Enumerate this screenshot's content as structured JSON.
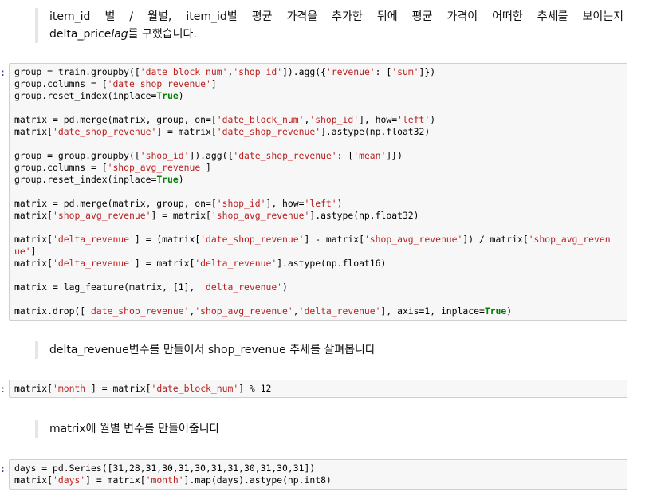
{
  "markdown": {
    "m1_line1": "item_id 별 / 월별, item_id별 평균 가격을 추가한 뒤에 평균 가격이 어떠한 추세를 보이는지",
    "m1_line2_pre": "delta_price",
    "m1_line2_em": "lag",
    "m1_line2_post": "를 구했습니다.",
    "m2": "delta_revenue변수를 만들어서 shop_revenue 추세를 살펴봅니다",
    "m3": "matrix에 월별 변수를 만들어줍니다"
  },
  "prompt_glyph": ":",
  "cells": [
    {
      "lines": [
        [
          [
            "group = train.groupby(["
          ],
          [
            "'date_block_num'",
            "s"
          ],
          [
            ","
          ],
          [
            "'shop_id'",
            "s"
          ],
          [
            "]).agg({"
          ],
          [
            "'revenue'",
            "s"
          ],
          [
            ": ["
          ],
          [
            "'sum'",
            "s"
          ],
          [
            "]})"
          ]
        ],
        [
          [
            "group.columns = ["
          ],
          [
            "'date_shop_revenue'",
            "s"
          ],
          [
            "]"
          ]
        ],
        [
          [
            "group.reset_index(inplace="
          ],
          [
            "True",
            "k"
          ],
          [
            ")"
          ]
        ],
        [
          [
            ""
          ]
        ],
        [
          [
            "matrix = pd.merge(matrix, group, on=["
          ],
          [
            "'date_block_num'",
            "s"
          ],
          [
            ","
          ],
          [
            "'shop_id'",
            "s"
          ],
          [
            "], how="
          ],
          [
            "'left'",
            "s"
          ],
          [
            ")"
          ]
        ],
        [
          [
            "matrix["
          ],
          [
            "'date_shop_revenue'",
            "s"
          ],
          [
            "] = matrix["
          ],
          [
            "'date_shop_revenue'",
            "s"
          ],
          [
            "].astype(np.float32)"
          ]
        ],
        [
          [
            ""
          ]
        ],
        [
          [
            "group = group.groupby(["
          ],
          [
            "'shop_id'",
            "s"
          ],
          [
            "]).agg({"
          ],
          [
            "'date_shop_revenue'",
            "s"
          ],
          [
            ": ["
          ],
          [
            "'mean'",
            "s"
          ],
          [
            "]})"
          ]
        ],
        [
          [
            "group.columns = ["
          ],
          [
            "'shop_avg_revenue'",
            "s"
          ],
          [
            "]"
          ]
        ],
        [
          [
            "group.reset_index(inplace="
          ],
          [
            "True",
            "k"
          ],
          [
            ")"
          ]
        ],
        [
          [
            ""
          ]
        ],
        [
          [
            "matrix = pd.merge(matrix, group, on=["
          ],
          [
            "'shop_id'",
            "s"
          ],
          [
            "], how="
          ],
          [
            "'left'",
            "s"
          ],
          [
            ")"
          ]
        ],
        [
          [
            "matrix["
          ],
          [
            "'shop_avg_revenue'",
            "s"
          ],
          [
            "] = matrix["
          ],
          [
            "'shop_avg_revenue'",
            "s"
          ],
          [
            "].astype(np.float32)"
          ]
        ],
        [
          [
            ""
          ]
        ],
        [
          [
            "matrix["
          ],
          [
            "'delta_revenue'",
            "s"
          ],
          [
            "] = (matrix["
          ],
          [
            "'date_shop_revenue'",
            "s"
          ],
          [
            "] - matrix["
          ],
          [
            "'shop_avg_revenue'",
            "s"
          ],
          [
            "]) / matrix["
          ],
          [
            "'shop_avg_reven",
            "s"
          ]
        ],
        [
          [
            "ue'",
            "s"
          ],
          [
            "]"
          ]
        ],
        [
          [
            "matrix["
          ],
          [
            "'delta_revenue'",
            "s"
          ],
          [
            "] = matrix["
          ],
          [
            "'delta_revenue'",
            "s"
          ],
          [
            "].astype(np.float16)"
          ]
        ],
        [
          [
            ""
          ]
        ],
        [
          [
            "matrix = lag_feature(matrix, [1], "
          ],
          [
            "'delta_revenue'",
            "s"
          ],
          [
            ")"
          ]
        ],
        [
          [
            ""
          ]
        ],
        [
          [
            "matrix.drop(["
          ],
          [
            "'date_shop_revenue'",
            "s"
          ],
          [
            ","
          ],
          [
            "'shop_avg_revenue'",
            "s"
          ],
          [
            ","
          ],
          [
            "'delta_revenue'",
            "s"
          ],
          [
            "], axis=1, inplace="
          ],
          [
            "True",
            "k"
          ],
          [
            ")"
          ]
        ]
      ]
    },
    {
      "lines": [
        [
          [
            "matrix["
          ],
          [
            "'month'",
            "s"
          ],
          [
            "] = matrix["
          ],
          [
            "'date_block_num'",
            "s"
          ],
          [
            "] % 12"
          ]
        ]
      ]
    },
    {
      "lines": [
        [
          [
            "days = pd.Series([31,28,31,30,31,30,31,31,30,31,30,31])"
          ]
        ],
        [
          [
            "matrix["
          ],
          [
            "'days'",
            "s"
          ],
          [
            "] = matrix["
          ],
          [
            "'month'",
            "s"
          ],
          [
            "].map(days).astype(np.int8)"
          ]
        ]
      ]
    }
  ]
}
